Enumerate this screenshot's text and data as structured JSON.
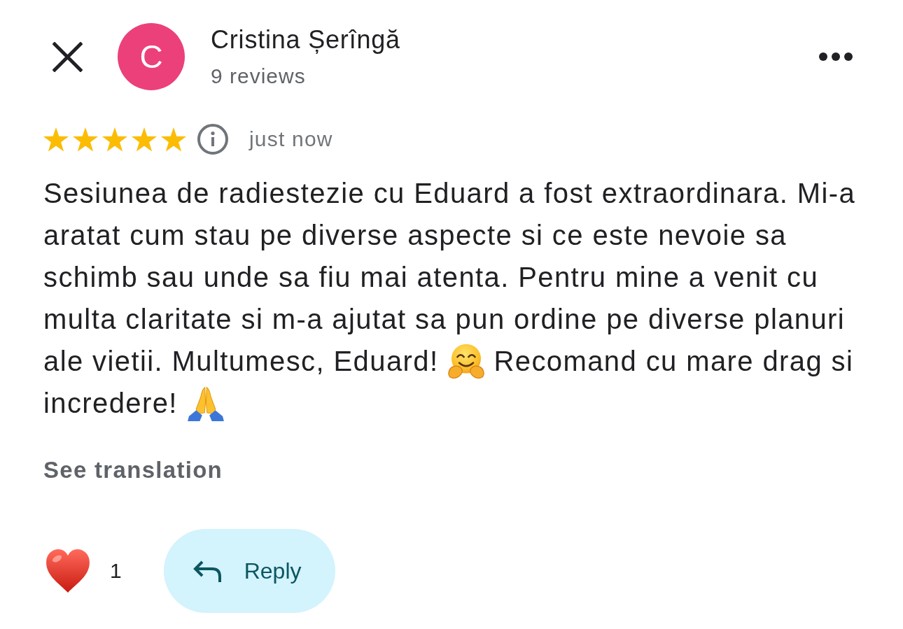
{
  "author": {
    "initial": "C",
    "name": "Cristina Șerîngă",
    "reviews": "9 reviews"
  },
  "review": {
    "stars": 5,
    "time": "just now",
    "body": [
      "Sesiunea de radiestezie cu Eduard a fost extraordinara. Mi-a aratat cum stau pe diverse aspecte si ce este nevoie sa schimb sau unde sa fiu mai atenta. Pentru mine a venit cu multa claritate si m-a ajutat sa pun ordine pe diverse planuri ale vietii. Multumesc, Eduard!",
      "Recomand cu mare drag si incredere!"
    ],
    "translate_link": "See translation"
  },
  "actions": {
    "reaction_count": "1",
    "reply_button": "Reply"
  }
}
